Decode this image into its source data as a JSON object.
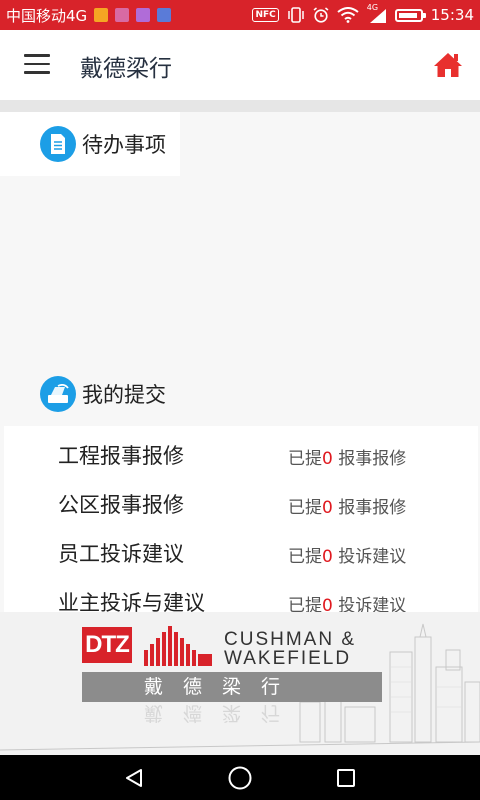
{
  "status_bar": {
    "carrier": "中国移动4G",
    "network": "4G",
    "time": "15:34",
    "nfc": "NFC",
    "battery_level": 0.9,
    "bg_color": "#d8232a"
  },
  "header": {
    "title": "戴德梁行",
    "menu_icon": "menu-icon",
    "home_icon": "home-icon",
    "home_color": "#e8302e"
  },
  "todo": {
    "title": "待办事项",
    "icon": "document-icon"
  },
  "submissions": {
    "title": "我的提交",
    "icon": "submit-icon",
    "items": [
      {
        "label": "工程报事报修",
        "prefix": "已提",
        "count": "0",
        "suffix": " 报事报修"
      },
      {
        "label": "公区报事报修",
        "prefix": "已提",
        "count": "0",
        "suffix": " 报事报修"
      },
      {
        "label": "员工投诉建议",
        "prefix": "已提",
        "count": "0",
        "suffix": " 投诉建议"
      },
      {
        "label": "业主投诉与建议",
        "prefix": "已提",
        "count": "0",
        "suffix": " 投诉建议"
      }
    ]
  },
  "banner": {
    "dtz": "DTZ",
    "cw_line1": "CUSHMAN &",
    "cw_line2": "WAKEFIELD",
    "chinese_name": "戴德梁行"
  },
  "nav": {
    "back": "back-icon",
    "home": "home-circle-icon",
    "recent": "recent-apps-icon"
  }
}
